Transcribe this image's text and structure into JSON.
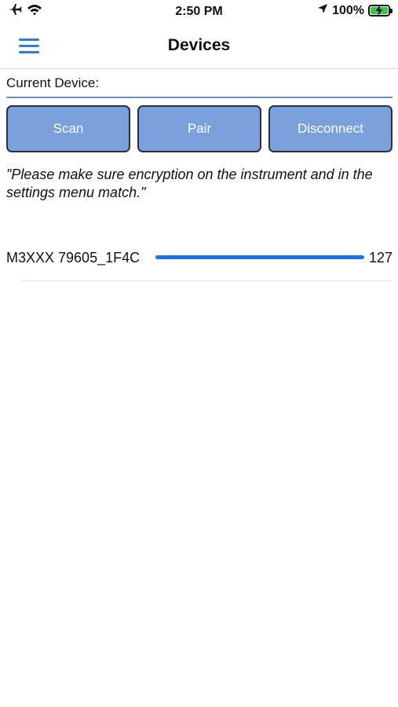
{
  "status_bar": {
    "time": "2:50 PM",
    "battery_percent": "100%",
    "icons": [
      "airplane-icon",
      "wifi-icon",
      "location-icon",
      "battery-charging-icon"
    ]
  },
  "nav": {
    "title": "Devices",
    "menu_icon": "hamburger-menu-icon"
  },
  "current_device": {
    "label": "Current Device:"
  },
  "buttons": {
    "scan": "Scan",
    "pair": "Pair",
    "disconnect": "Disconnect"
  },
  "notice": "\"Please make sure encryption on the instrument and in the settings menu match.\"",
  "devices": [
    {
      "name": "M3XXX 79605_1F4C",
      "signal": "127",
      "signal_fraction": 1.0
    }
  ],
  "colors": {
    "button_fill": "#7ba0dc",
    "accent_line": "#6a8cc7",
    "signal_blue": "#1a73e8",
    "menu_blue": "#2f7fd6",
    "battery_green": "#3cc44a"
  }
}
